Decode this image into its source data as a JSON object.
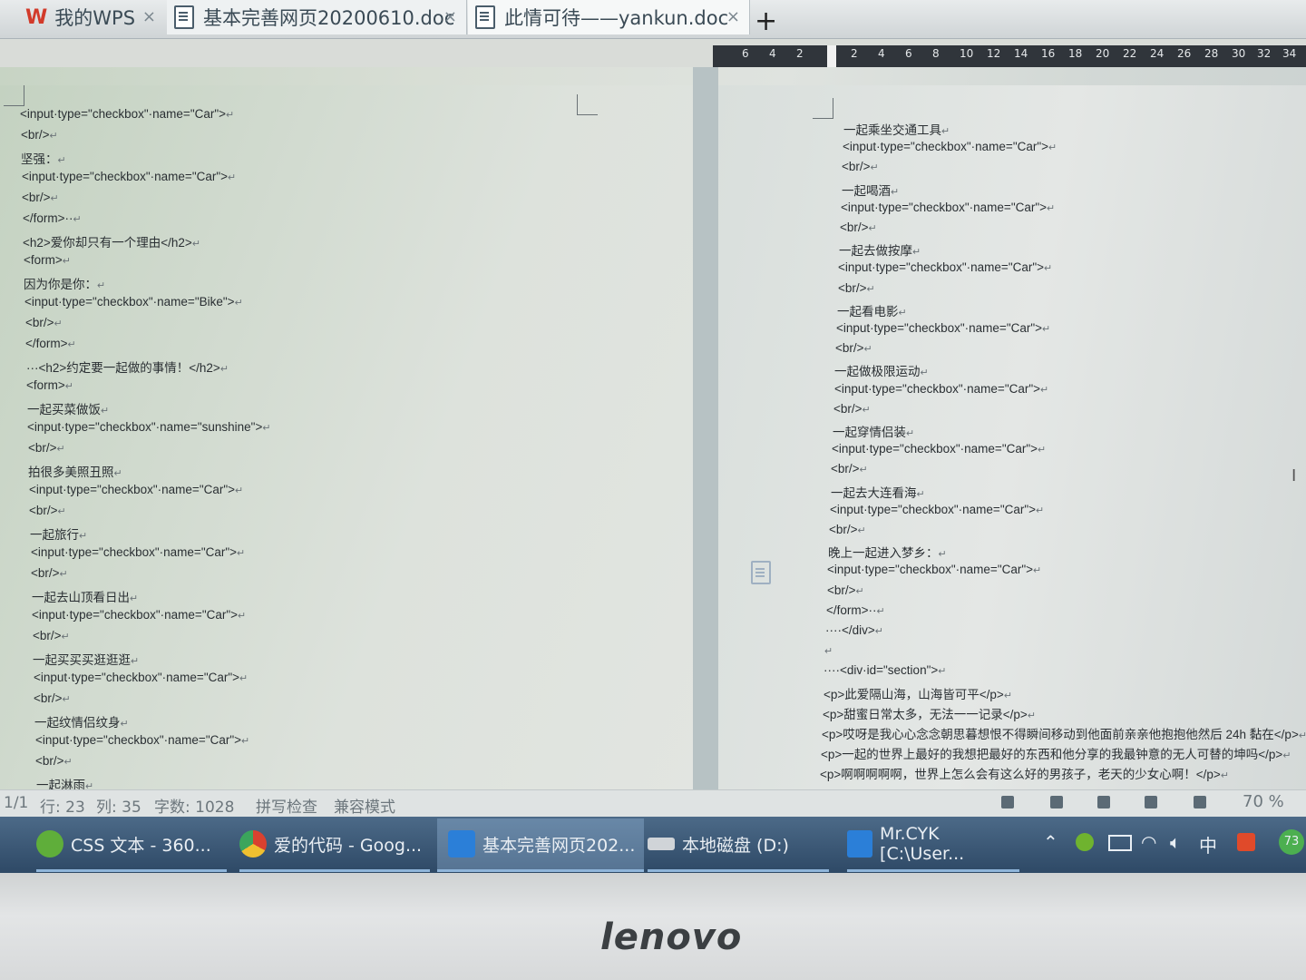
{
  "tabs": [
    {
      "label": "我的WPS",
      "close": "×"
    },
    {
      "label": "基本完善网页20200610.doc",
      "close": "×"
    },
    {
      "label": "此情可待——yankun.doc",
      "close": "×"
    }
  ],
  "new_tab": "+",
  "ruler": [
    "6",
    "4",
    "2",
    "2",
    "4",
    "6",
    "8",
    "10",
    "12",
    "14",
    "16",
    "18",
    "20",
    "22",
    "24",
    "26",
    "28",
    "30",
    "32",
    "34"
  ],
  "left_lines": [
    "<input·type=\"checkbox\"·name=\"Car\">",
    "<br/>",
    "坚强：",
    "<input·type=\"checkbox\"·name=\"Car\">",
    "<br/>",
    "</form>··",
    "<h2>爱你却只有一个理由</h2>",
    "<form>",
    "因为你是你：",
    "<input·type=\"checkbox\"·name=\"Bike\">",
    "<br/>",
    "</form>",
    "···<h2>约定要一起做的事情！</h2>",
    "<form>",
    "一起买菜做饭",
    "<input·type=\"checkbox\"·name=\"sunshine\">",
    "<br/>",
    "拍很多美照丑照",
    "<input·type=\"checkbox\"·name=\"Car\">",
    "<br/>",
    "一起旅行",
    "<input·type=\"checkbox\"·name=\"Car\">",
    "<br/>",
    "一起去山顶看日出",
    "<input·type=\"checkbox\"·name=\"Car\">",
    "<br/>",
    "一起买买买逛逛逛",
    "<input·type=\"checkbox\"·name=\"Car\">",
    "<br/>",
    "一起纹情侣纹身",
    "<input·type=\"checkbox\"·name=\"Car\">",
    "<br/>",
    "一起淋雨"
  ],
  "right_lines": [
    "一起乘坐交通工具",
    "<input·type=\"checkbox\"·name=\"Car\">",
    "<br/>",
    "一起喝酒",
    "<input·type=\"checkbox\"·name=\"Car\">",
    "<br/>",
    "一起去做按摩",
    "<input·type=\"checkbox\"·name=\"Car\">",
    "<br/>",
    "一起看电影",
    "<input·type=\"checkbox\"·name=\"Car\">",
    "<br/>",
    "一起做极限运动",
    "<input·type=\"checkbox\"·name=\"Car\">",
    "<br/>",
    "一起穿情侣装",
    "<input·type=\"checkbox\"·name=\"Car\">",
    "<br/>",
    "一起去大连看海",
    "<input·type=\"checkbox\"·name=\"Car\">",
    "<br/>",
    "晚上一起进入梦乡：",
    "<input·type=\"checkbox\"·name=\"Car\">",
    "<br/>",
    "</form>··",
    "····</div>",
    "",
    "····<div·id=\"section\">",
    "<p>此爱隔山海，山海皆可平</p>",
    "<p>甜蜜日常太多，无法一一记录</p>",
    "<p>哎呀是我心心念念朝思暮想恨不得瞬间移动到他面前亲亲他抱抱他然后 24h 黏在</p>",
    "<p>一起的世界上最好的我想把最好的东西和他分享的我最钟意的无人可替的坤吗</p>",
    "<p>啊啊啊啊啊，世界上怎么会有这么好的男孩子，老天的少女心啊！</p>"
  ],
  "paragraph_mark": "↵",
  "status": {
    "page": "1/1",
    "row": "行: 23",
    "col": "列: 35",
    "words": "字数: 1028",
    "spell": "拼写检查",
    "compat": "兼容模式",
    "zoom": "70 %"
  },
  "taskbar": [
    {
      "label": "CSS 文本 - 360...",
      "color": "#3a8f3a"
    },
    {
      "label": "爱的代码 - Goog...",
      "color": "#e0b02a"
    },
    {
      "label": "基本完善网页202...",
      "color": "#2b7fd8"
    },
    {
      "label": "本地磁盘 (D:)",
      "color": "#d0d4d8"
    },
    {
      "label": "Mr.CYK [C:\\User...",
      "color": "#2b7fd8"
    }
  ],
  "tray": {
    "ime": "中",
    "badge": "73"
  },
  "brand": "lenovo"
}
